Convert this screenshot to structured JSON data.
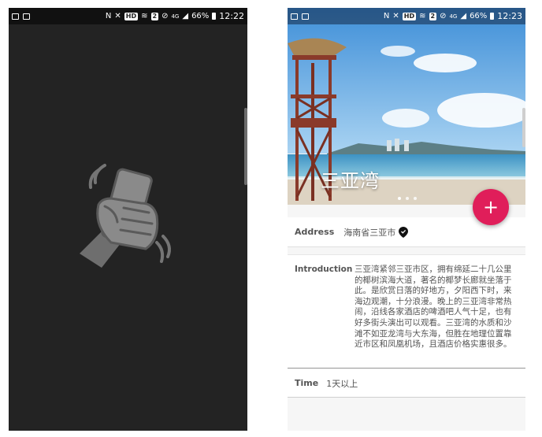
{
  "left_screen": {
    "status": {
      "hd": "HD",
      "sim": "2",
      "network": "4G",
      "battery": "66%",
      "time": "12:22"
    },
    "splash_icon": "fist-phone-icon"
  },
  "right_screen": {
    "status": {
      "hd": "HD",
      "sim": "2",
      "network": "4G",
      "battery": "66%",
      "time": "12:23"
    },
    "hero": {
      "title": "三亚湾",
      "carousel_pages": 3,
      "active_page": 1
    },
    "fab_label": "+",
    "address": {
      "label": "Address",
      "value": "海南省三亚市"
    },
    "introduction": {
      "label": "Introduction",
      "text": "三亚湾紧邻三亚市区，拥有绵延二十几公里的椰树滨海大道，著名的椰梦长廊就坐落于此。是欣赏日落的好地方，夕阳西下时，来海边观潮，十分浪漫。晚上的三亚湾非常热闹，沿线各家酒店的啤酒吧人气十足，也有好多街头演出可以观看。三亚湾的水质和沙滩不如亚龙湾与大东海，但胜在地理位置靠近市区和凤凰机场，且酒店价格实惠很多。"
    },
    "time": {
      "label": "Time",
      "value": "1天以上"
    }
  },
  "colors": {
    "fab": "#e01e5a",
    "splash_bg": "#232323",
    "icon_gray": "#757575"
  }
}
